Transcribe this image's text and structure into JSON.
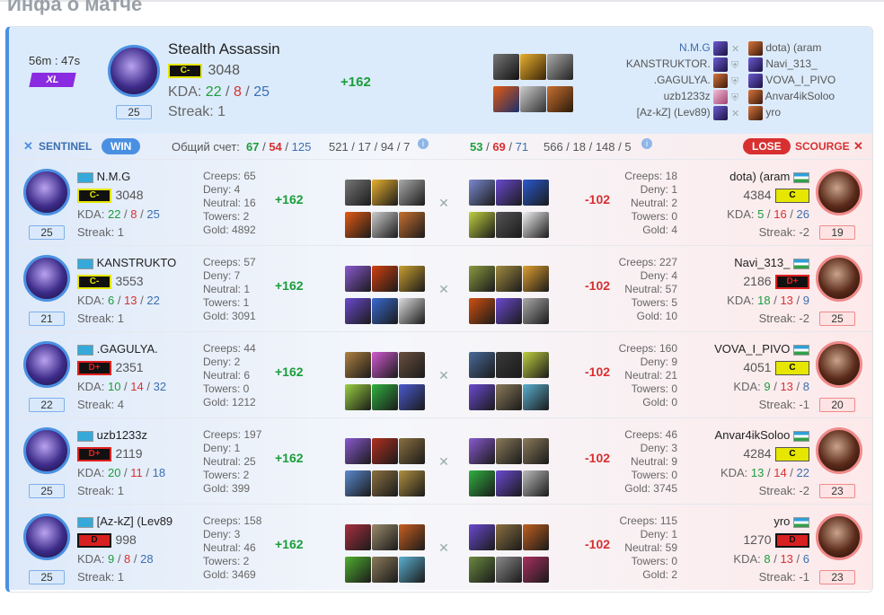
{
  "page_title": "Инфа о матче",
  "match": {
    "duration": "56m : 47s",
    "mode": "XL",
    "hero_name": "Stealth Assassin",
    "rank": "C-",
    "mmr": "3048",
    "kda_label": "KDA:",
    "k": "22",
    "d": "8",
    "a": "25",
    "streak_label": "Streak: 1",
    "level": "25",
    "mmr_change": "+162",
    "roster": [
      {
        "left": "N.M.G",
        "right": "dota) (aram"
      },
      {
        "left": "KANSTRUKTOR.",
        "right": "Navi_313_"
      },
      {
        "left": ".GAGULYA.",
        "right": "VOVA_I_PIVO"
      },
      {
        "left": "uzb1233z",
        "right": "Anvar4ikSoloo"
      },
      {
        "left": "[Az-kZ] (Lev89)",
        "right": "yro"
      }
    ]
  },
  "scorebar": {
    "sentinel": "SENTINEL",
    "win": "WIN",
    "total_label": "Общий счет:",
    "s_k": "67",
    "s_d": "54",
    "s_a": "125",
    "s_stats": "521 / 17 / 94 / 7",
    "r_k": "53",
    "r_d": "69",
    "r_a": "71",
    "r_stats": "566 / 18 / 148 / 5",
    "lose": "LOSE",
    "scourge": "SCOURGE"
  },
  "players": [
    {
      "l": {
        "name": "N.M.G",
        "rank": "C-",
        "mmr": "3048",
        "k": "22",
        "d": "8",
        "a": "25",
        "streak": "Streak: 1",
        "level": "25",
        "creeps": "Creeps: 65",
        "deny": "Deny: 4",
        "neutral": "Neutral: 16",
        "towers": "Towers: 2",
        "gold": "Gold: 4892",
        "diff": "+162"
      },
      "r": {
        "name": "dota) (aram",
        "rank": "C",
        "mmr": "4384",
        "k": "5",
        "d": "16",
        "a": "26",
        "streak": "Streak: -2",
        "level": "19",
        "creeps": "Creeps: 18",
        "deny": "Deny: 1",
        "neutral": "Neutral: 2",
        "towers": "Towers: 0",
        "gold": "Gold: 4",
        "diff": "-102"
      }
    },
    {
      "l": {
        "name": "KANSTRUKTO",
        "rank": "C-",
        "mmr": "3553",
        "k": "6",
        "d": "13",
        "a": "22",
        "streak": "Streak: 1",
        "level": "21",
        "creeps": "Creeps: 57",
        "deny": "Deny: 7",
        "neutral": "Neutral: 1",
        "towers": "Towers: 1",
        "gold": "Gold: 3091",
        "diff": "+162"
      },
      "r": {
        "name": "Navi_313_",
        "rank": "D+",
        "mmr": "2186",
        "k": "18",
        "d": "13",
        "a": "9",
        "streak": "Streak: -2",
        "level": "25",
        "creeps": "Creeps: 227",
        "deny": "Deny: 4",
        "neutral": "Neutral: 57",
        "towers": "Towers: 5",
        "gold": "Gold: 10",
        "diff": "-102"
      }
    },
    {
      "l": {
        "name": ".GAGULYA.",
        "rank": "D+",
        "mmr": "2351",
        "k": "10",
        "d": "14",
        "a": "32",
        "streak": "Streak: 4",
        "level": "22",
        "creeps": "Creeps: 44",
        "deny": "Deny: 2",
        "neutral": "Neutral: 6",
        "towers": "Towers: 0",
        "gold": "Gold: 1212",
        "diff": "+162"
      },
      "r": {
        "name": "VOVA_I_PIVO",
        "rank": "C",
        "mmr": "4051",
        "k": "9",
        "d": "13",
        "a": "8",
        "streak": "Streak: -1",
        "level": "20",
        "creeps": "Creeps: 160",
        "deny": "Deny: 9",
        "neutral": "Neutral: 21",
        "towers": "Towers: 0",
        "gold": "Gold: 0",
        "diff": "-102"
      }
    },
    {
      "l": {
        "name": "uzb1233z",
        "rank": "D+",
        "mmr": "2119",
        "k": "20",
        "d": "11",
        "a": "18",
        "streak": "Streak: 1",
        "level": "25",
        "creeps": "Creeps: 197",
        "deny": "Deny: 1",
        "neutral": "Neutral: 25",
        "towers": "Towers: 2",
        "gold": "Gold: 399",
        "diff": "+162"
      },
      "r": {
        "name": "Anvar4ikSoloo",
        "rank": "C",
        "mmr": "4284",
        "k": "13",
        "d": "14",
        "a": "22",
        "streak": "Streak: -2",
        "level": "23",
        "creeps": "Creeps: 46",
        "deny": "Deny: 3",
        "neutral": "Neutral: 9",
        "towers": "Towers: 0",
        "gold": "Gold: 3745",
        "diff": "-102"
      }
    },
    {
      "l": {
        "name": "[Az-kZ] (Lev89",
        "rank": "D",
        "mmr": "998",
        "k": "9",
        "d": "8",
        "a": "28",
        "streak": "Streak: 1",
        "level": "25",
        "creeps": "Creeps: 158",
        "deny": "Deny: 3",
        "neutral": "Neutral: 46",
        "towers": "Towers: 2",
        "gold": "Gold: 3469",
        "diff": "+162"
      },
      "r": {
        "name": "yro",
        "rank": "D",
        "mmr": "1270",
        "k": "8",
        "d": "13",
        "a": "6",
        "streak": "Streak: -1",
        "level": "23",
        "creeps": "Creeps: 115",
        "deny": "Deny: 1",
        "neutral": "Neutral: 59",
        "towers": "Towers: 0",
        "gold": "Gold: 2",
        "diff": "-102"
      }
    }
  ],
  "colors": {
    "accent": "#4a90e2",
    "win": "#1a9e3a",
    "lose": "#d83030",
    "xl": "#8a2be2"
  }
}
